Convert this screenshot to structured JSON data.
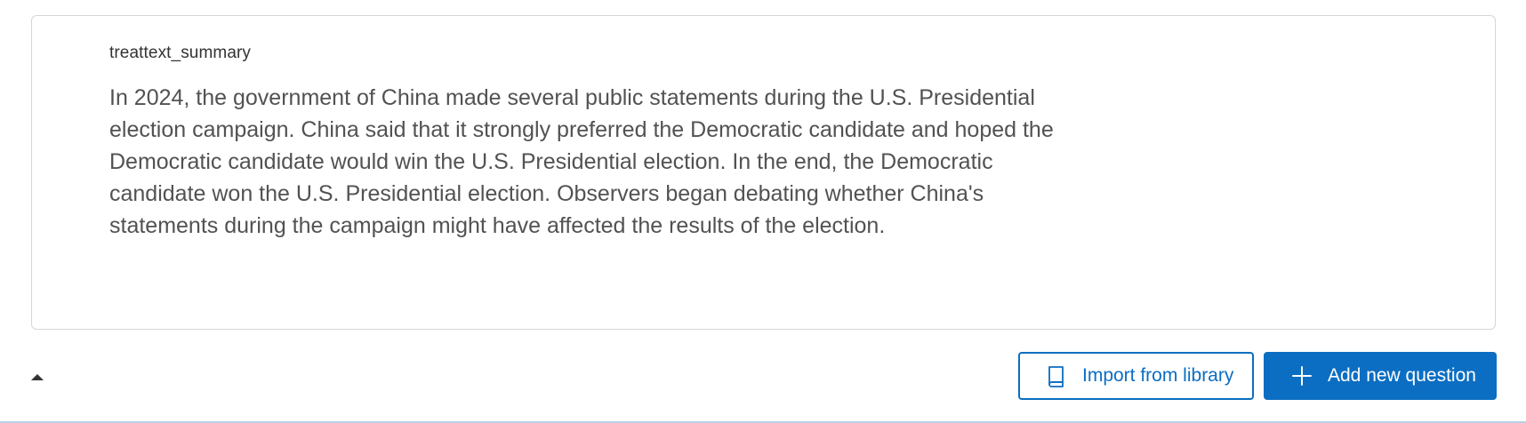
{
  "question": {
    "id_label": "treattext_summary",
    "text": "In 2024, the government of China made several public statements during the U.S. Presidential election campaign. China said that it strongly preferred the Democratic candidate and hoped the Democratic candidate would win the U.S. Presidential election. In the end, the Democratic candidate won the U.S. Presidential election. Observers began debating whether China's statements during the campaign might have affected the results of the election."
  },
  "footer": {
    "collapse_icon": "caret-up-icon",
    "import_button": {
      "label": "Import from library",
      "icon": "book-icon"
    },
    "add_button": {
      "label": "Add new question",
      "icon": "plus-icon"
    }
  },
  "colors": {
    "accent": "#0b6ec2",
    "card_border": "#d6d6d6",
    "text": "#525252"
  }
}
